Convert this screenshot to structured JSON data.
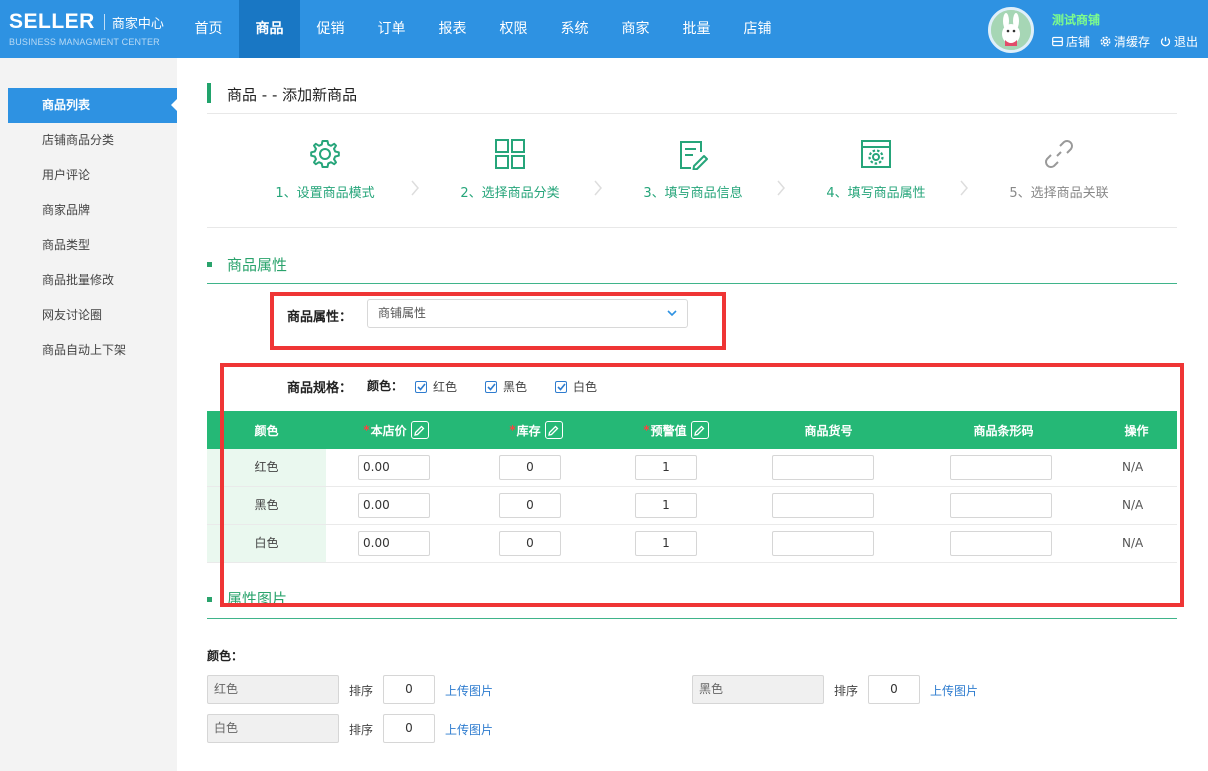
{
  "header": {
    "brand": "SELLER",
    "brand_center": "商家中心",
    "brand_sub": "BUSINESS MANAGMENT CENTER",
    "nav": [
      "首页",
      "商品",
      "促销",
      "订单",
      "报表",
      "权限",
      "系统",
      "商家",
      "批量",
      "店铺"
    ],
    "active_nav": "商品",
    "shop_name": "测试商铺",
    "links": {
      "store": "店铺",
      "clear_cache": "清缓存",
      "logout": "退出"
    }
  },
  "sidebar": {
    "items": [
      "商品列表",
      "店铺商品分类",
      "用户评论",
      "商家品牌",
      "商品类型",
      "商品批量修改",
      "网友讨论圈",
      "商品自动上下架"
    ],
    "active": "商品列表"
  },
  "page": {
    "title": "商品 - - 添加新商品"
  },
  "steps": [
    {
      "label": "1、设置商品模式",
      "icon": "gear-icon"
    },
    {
      "label": "2、选择商品分类",
      "icon": "grid-icon"
    },
    {
      "label": "3、填写商品信息",
      "icon": "edit-doc-icon"
    },
    {
      "label": "4、填写商品属性",
      "icon": "settings-window-icon"
    },
    {
      "label": "5、选择商品关联",
      "icon": "link-icon"
    }
  ],
  "attributes": {
    "section_title": "商品属性",
    "attr_label": "商品属性：",
    "attr_selected": "商铺属性",
    "spec_label": "商品规格：",
    "color_label": "颜色：",
    "colors": [
      "红色",
      "黑色",
      "白色"
    ]
  },
  "spec_table": {
    "headers": {
      "color": "颜色",
      "price": "本店价",
      "stock": "库存",
      "warn": "预警值",
      "sku": "商品货号",
      "barcode": "商品条形码",
      "action": "操作"
    },
    "rows": [
      {
        "color": "红色",
        "price": "0.00",
        "stock": "0",
        "warn": "1",
        "sku": "",
        "barcode": "",
        "action": "N/A"
      },
      {
        "color": "黑色",
        "price": "0.00",
        "stock": "0",
        "warn": "1",
        "sku": "",
        "barcode": "",
        "action": "N/A"
      },
      {
        "color": "白色",
        "price": "0.00",
        "stock": "0",
        "warn": "1",
        "sku": "",
        "barcode": "",
        "action": "N/A"
      }
    ]
  },
  "attr_images": {
    "section_title": "属性图片",
    "color_label": "颜色：",
    "sort_label": "排序",
    "upload_label": "上传图片",
    "items": [
      {
        "color": "红色",
        "sort": "0"
      },
      {
        "color": "黑色",
        "sort": "0"
      },
      {
        "color": "白色",
        "sort": "0"
      }
    ]
  },
  "colors": {
    "primary": "#2e92e2",
    "nav_active": "#1977c4",
    "green": "#25b876",
    "highlight": "#ef3535"
  }
}
